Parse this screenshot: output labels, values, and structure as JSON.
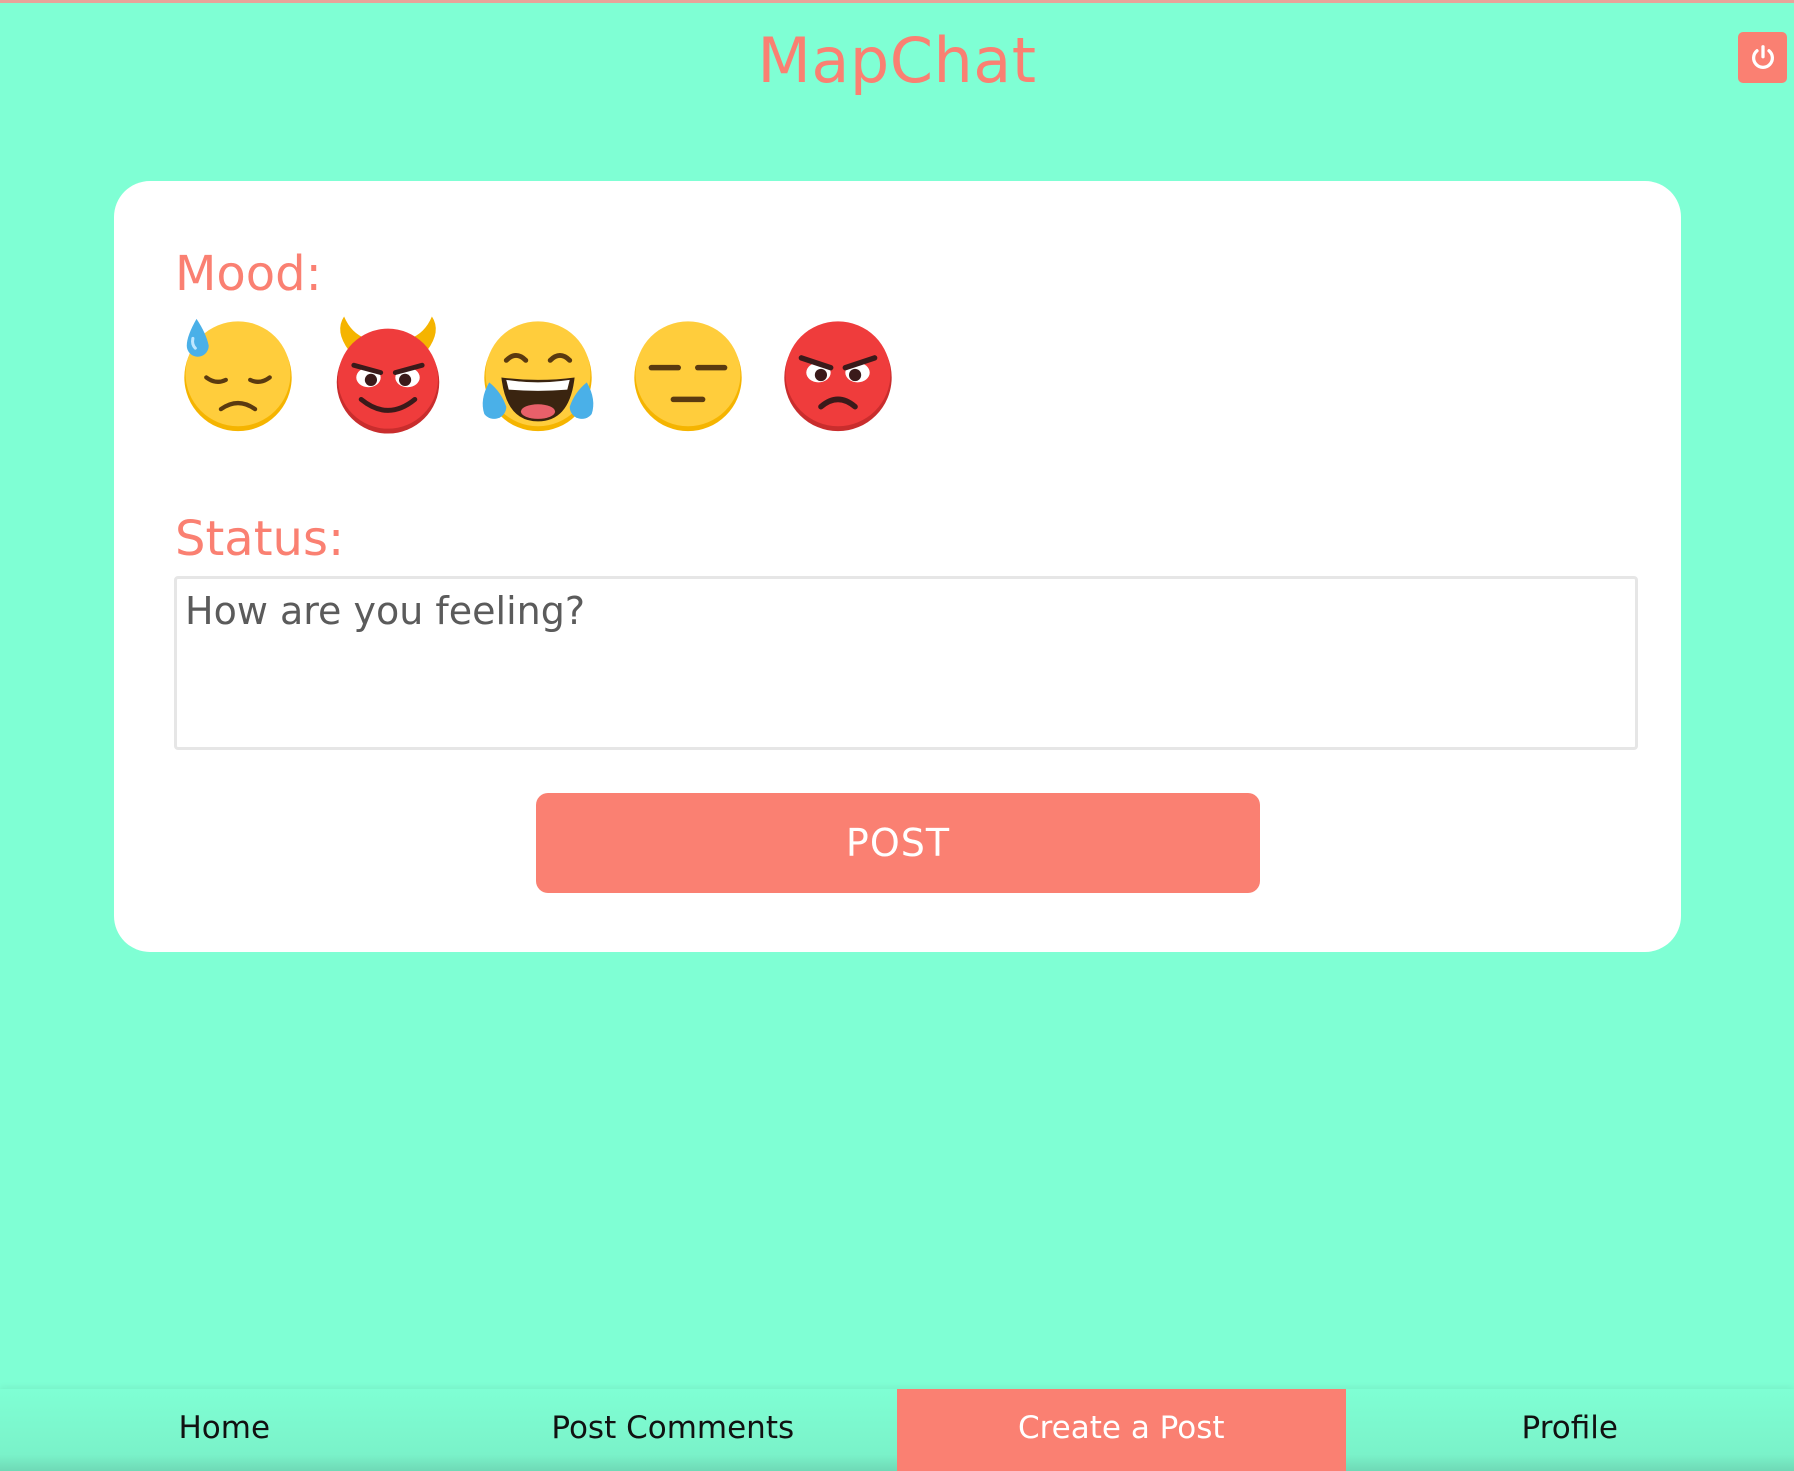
{
  "header": {
    "title": "MapChat",
    "power_icon": "power-icon"
  },
  "form": {
    "mood_label": "Mood:",
    "moods": [
      {
        "icon": "downcast-sweat-emoji"
      },
      {
        "icon": "smiling-devil-emoji"
      },
      {
        "icon": "tears-of-joy-emoji"
      },
      {
        "icon": "expressionless-emoji"
      },
      {
        "icon": "angry-emoji"
      }
    ],
    "status_label": "Status:",
    "status_placeholder": "How are you feeling?",
    "status_value": "",
    "post_label": "POST"
  },
  "nav": {
    "items": [
      {
        "label": "Home",
        "active": false
      },
      {
        "label": "Post Comments",
        "active": false
      },
      {
        "label": "Create a Post",
        "active": true
      },
      {
        "label": "Profile",
        "active": false
      }
    ]
  },
  "colors": {
    "background": "#7fffd4",
    "accent": "#fa8072",
    "card": "#ffffff"
  }
}
